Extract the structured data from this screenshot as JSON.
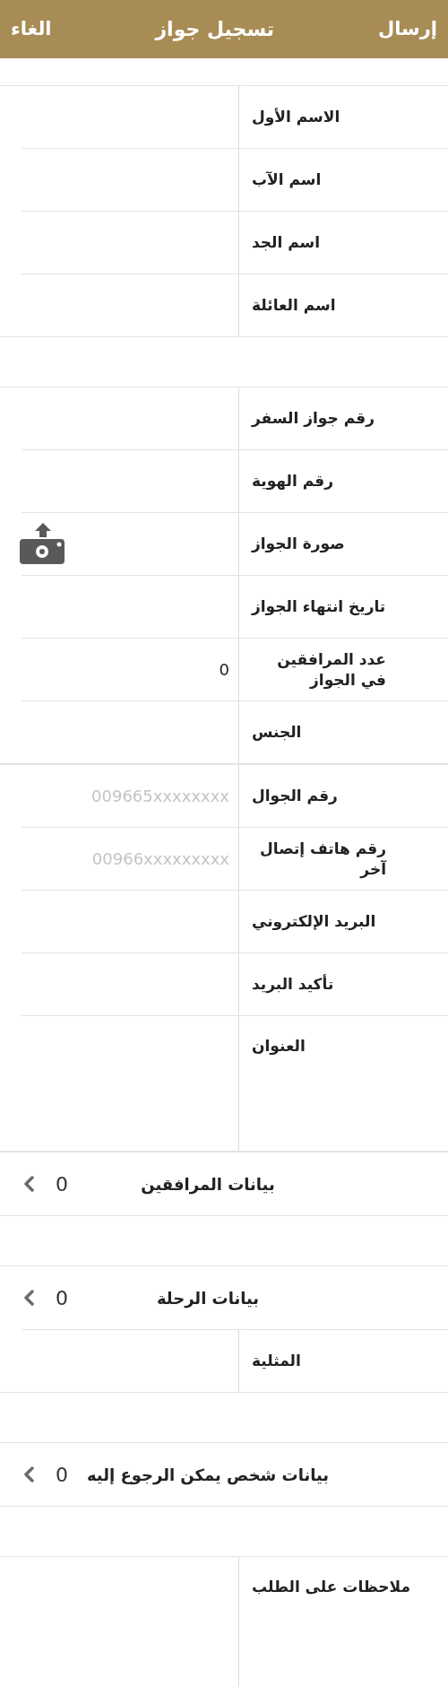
{
  "nav_bar": {
    "left_button": "الغاء",
    "title": "تسجيل جواز",
    "right_button": "إرسال"
  },
  "groups": [
    {
      "blocks": [
        [
          {
            "kind": "field",
            "label": "الاسم الأول"
          },
          {
            "kind": "field",
            "label": "اسم الآب"
          },
          {
            "kind": "field",
            "label": "اسم الجد"
          },
          {
            "kind": "field",
            "label": "اسم العائلة"
          }
        ]
      ]
    },
    {
      "blocks": [
        [
          {
            "kind": "field",
            "label": "رقم جواز السفر"
          },
          {
            "kind": "field",
            "label": "رقم الهوية"
          },
          {
            "kind": "photo",
            "label": "صورة الجواز"
          },
          {
            "kind": "field",
            "label": "تاريخ انتهاء الجواز"
          },
          {
            "kind": "field",
            "label": "عدد المرافقين في الجواز",
            "value": "0"
          },
          {
            "kind": "field",
            "label": "الجنس"
          }
        ],
        [
          {
            "kind": "field",
            "label": "رقم الجوال",
            "placeholder": "009665xxxxxxxx"
          },
          {
            "kind": "field",
            "label": "رقم هاتف إتصال آخر",
            "placeholder": "00966xxxxxxxxx"
          },
          {
            "kind": "field",
            "label": "البريد الإلكتروني"
          },
          {
            "kind": "field",
            "label": "تأكيد البريد"
          },
          {
            "kind": "textarea",
            "label": "العنوان"
          }
        ],
        [
          {
            "kind": "nav",
            "label": "بيانات المرافقين",
            "count": "0"
          }
        ]
      ]
    },
    {
      "blocks": [
        [
          {
            "kind": "nav",
            "label": "بيانات الرحلة",
            "count": "0"
          },
          {
            "kind": "field",
            "label": "المثلية"
          }
        ]
      ]
    },
    {
      "blocks": [
        [
          {
            "kind": "nav",
            "label": "بيانات شخص يمكن الرجوع إليه",
            "count": "0"
          }
        ]
      ]
    },
    {
      "blocks": [
        [
          {
            "kind": "textarea",
            "label": "ملاحظات على الطلب"
          }
        ]
      ]
    }
  ]
}
